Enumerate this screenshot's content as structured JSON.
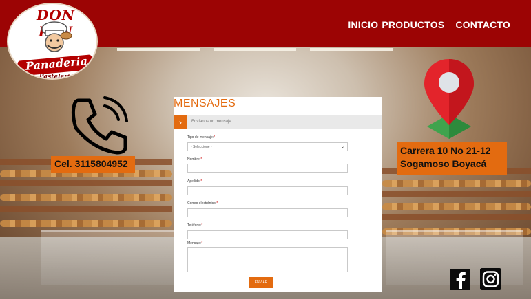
{
  "brand": {
    "logo_top": "DON PAN",
    "logo_ribbon": "Panaderia",
    "logo_sub": "Pasteleria"
  },
  "nav": {
    "items": [
      "INICIO",
      "PRODUCTOS",
      "CONTACTO"
    ]
  },
  "contact": {
    "phone": "Cel. 3115804952",
    "address_line1": "Carrera 10 No 21-12",
    "address_line2": "Sogamoso Boyacá"
  },
  "form": {
    "title": "MENSAJES",
    "tab_text": "Envíanos un mensaje",
    "fields": [
      {
        "label": "Tipo de mensaje:",
        "type": "select",
        "value": "- Seleccione -"
      },
      {
        "label": "Nombre:",
        "type": "text",
        "value": ""
      },
      {
        "label": "Apellido:",
        "type": "text",
        "value": ""
      },
      {
        "label": "Correo electrónico:",
        "type": "text",
        "value": ""
      },
      {
        "label": "Teléfono:",
        "type": "text",
        "value": ""
      },
      {
        "label": "Mensaje:",
        "type": "textarea",
        "value": ""
      }
    ],
    "required_mark": "*",
    "submit_label": "ENVIAR"
  },
  "social": {
    "icons": [
      "facebook-icon",
      "instagram-icon"
    ]
  },
  "colors": {
    "header_red": "#9c0404",
    "accent_orange": "#e36b10"
  }
}
